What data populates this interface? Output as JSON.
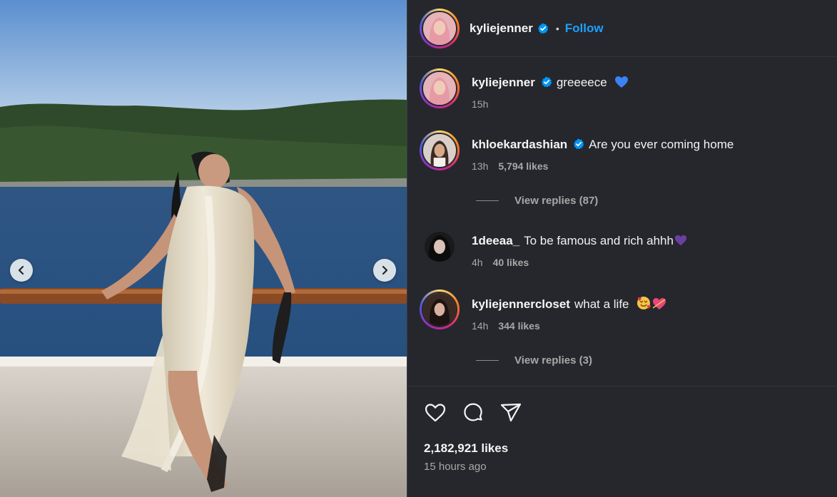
{
  "post": {
    "author": "kyliejenner",
    "separator": "•",
    "follow_label": "Follow",
    "likes": "2,182,921 likes",
    "posted": "15 hours ago"
  },
  "comments": [
    {
      "user": "kyliejenner",
      "verified": true,
      "text": "greeeece",
      "emoji": "blue-heart",
      "time": "15h",
      "likes": ""
    },
    {
      "user": "khloekardashian",
      "verified": true,
      "text": "Are you ever coming home",
      "emoji": "",
      "time": "13h",
      "likes": "5,794 likes",
      "replies": "View replies (87)"
    },
    {
      "user": "1deeaa_",
      "verified": false,
      "text": "To be famous and rich ahhh",
      "emoji": "purple-heart",
      "time": "4h",
      "likes": "40 likes"
    },
    {
      "user": "kyliejennercloset",
      "verified": false,
      "text": "what a life",
      "emoji": "smiling-face-with-hearts + heart-with-arrow",
      "time": "14h",
      "likes": "344 likes",
      "replies": "View replies (3)"
    }
  ],
  "icons": {
    "prev": "chevron-left-icon",
    "next": "chevron-right-icon",
    "like": "heart-icon",
    "comment": "comment-bubble-icon",
    "share": "paper-plane-icon",
    "verified": "verified-badge-icon"
  },
  "colors": {
    "panel_bg": "#25272c",
    "link_blue": "#1ea0ff",
    "verified_blue": "#0095f6",
    "muted_text": "#a8a8a8"
  }
}
